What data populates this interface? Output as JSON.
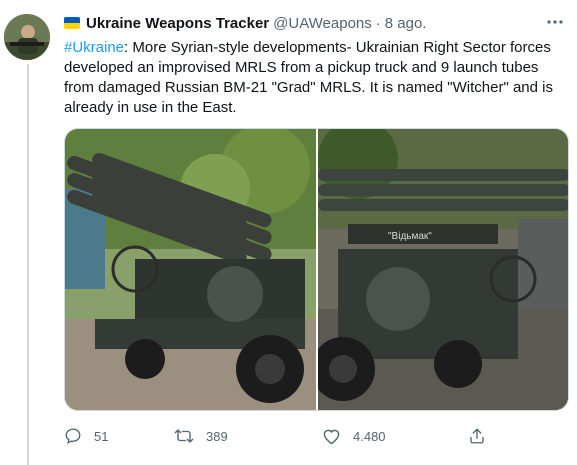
{
  "tweet": {
    "author": {
      "display_name": "Ukraine Weapons Tracker",
      "handle": "@UAWeapons",
      "separator": "·",
      "time": "8 ago.",
      "flag_icon": "ukraine-flag-icon"
    },
    "text": {
      "hashtag": "#Ukraine",
      "body": ": More Syrian-style developments- Ukrainian Right Sector forces developed an improvised MRLS from a pickup truck and 9 launch tubes from damaged Russian BM-21 \"Grad\" MRLS. It is named \"Witcher\" and is already in use in the East."
    },
    "photo_text": "\"Відьмак\"",
    "actions": {
      "reply_count": "51",
      "retweet_count": "389",
      "like_count": "4.480"
    },
    "icons": {
      "more": "more-icon",
      "reply": "reply-icon",
      "retweet": "retweet-icon",
      "like": "heart-icon",
      "share": "share-icon"
    },
    "colors": {
      "link": "#1d9bf0",
      "secondary": "#536471",
      "primary_text": "#0f1419"
    }
  }
}
